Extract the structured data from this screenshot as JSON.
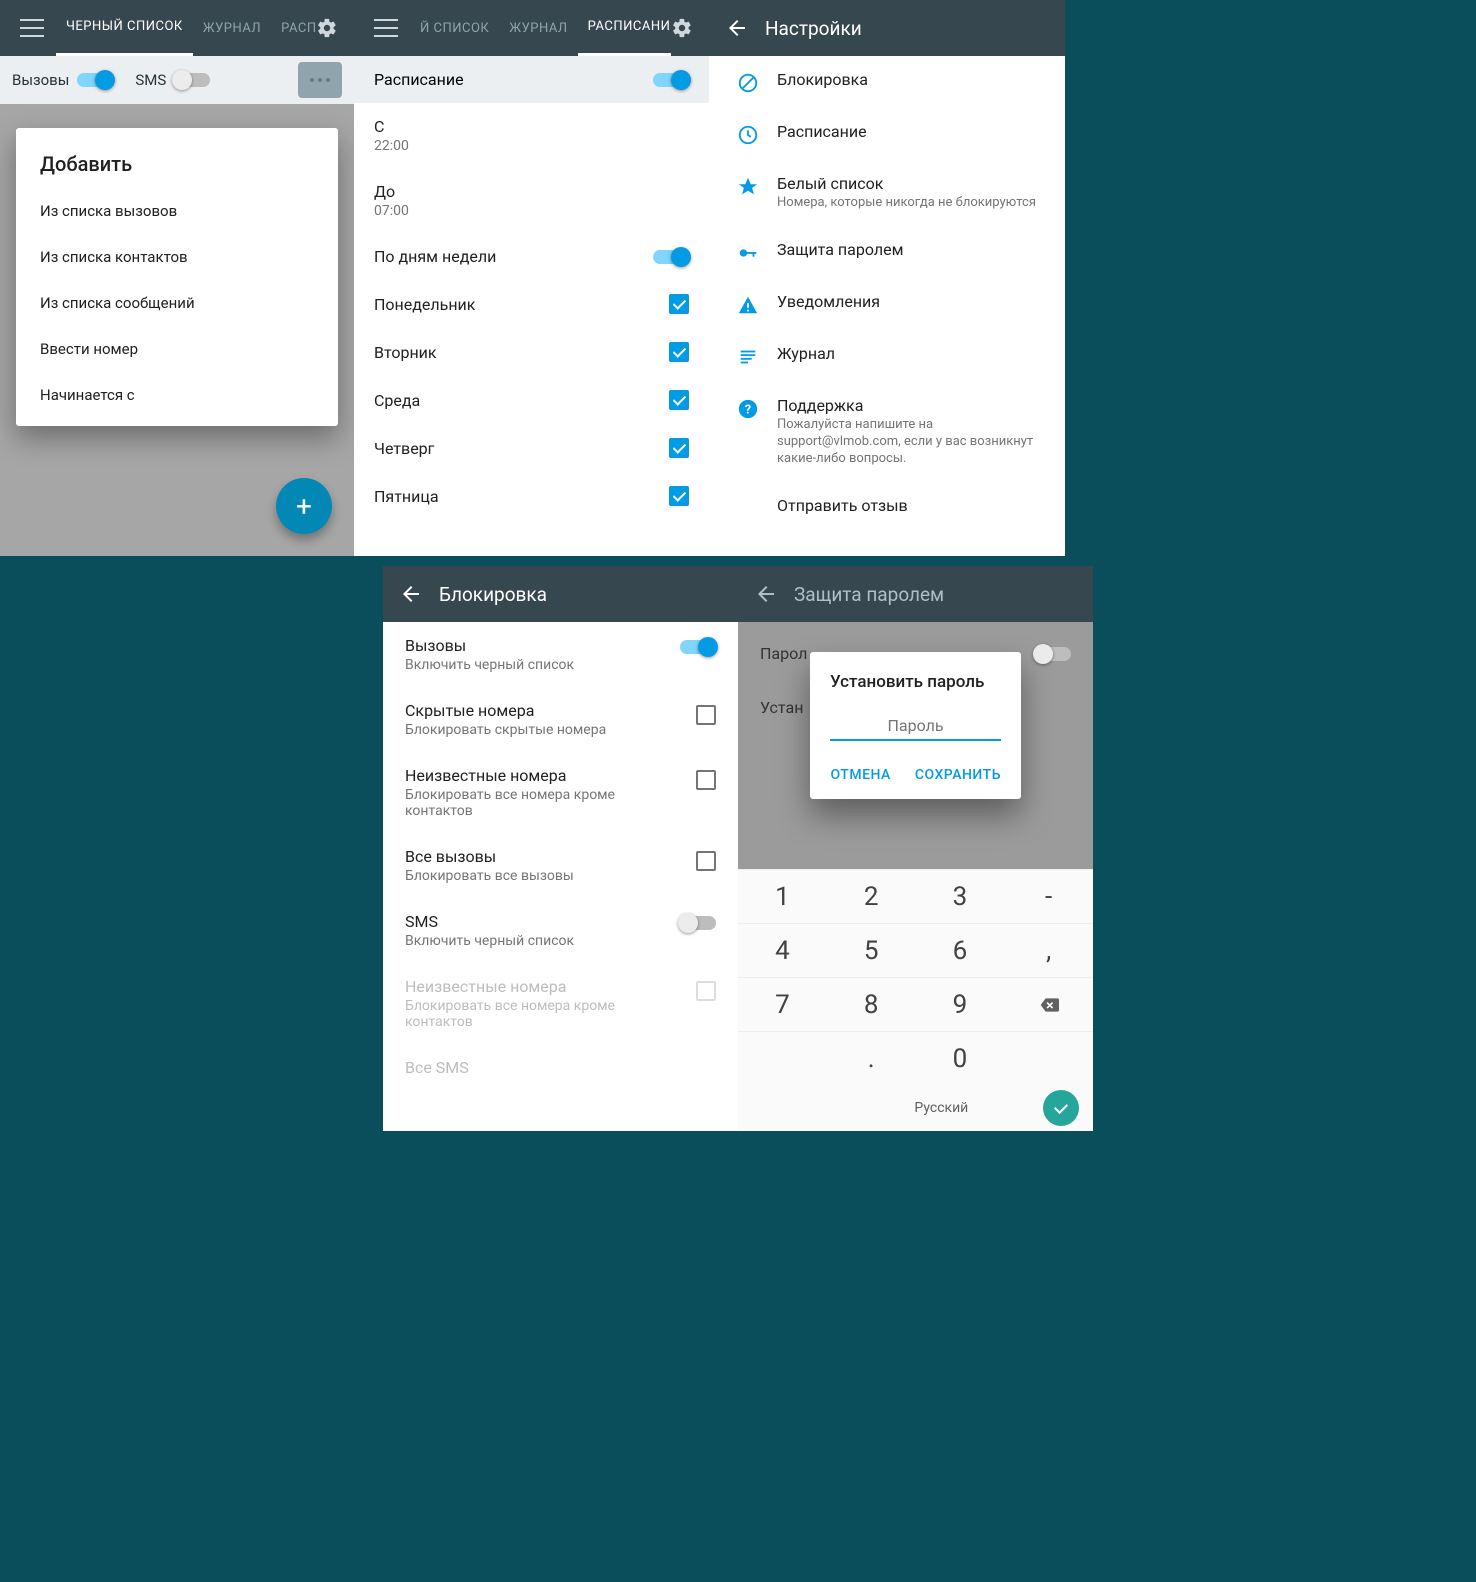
{
  "p1": {
    "tabs": [
      "ЧЕРНЫЙ СПИСОК",
      "ЖУРНАЛ",
      "РАСПИ"
    ],
    "filter": {
      "calls": "Вызовы",
      "sms": "SMS"
    },
    "dialog_title": "Добавить",
    "options": [
      "Из списка вызовов",
      "Из списка контактов",
      "Из списка сообщений",
      "Ввести номер",
      "Начинается с"
    ]
  },
  "p2": {
    "tabs": [
      "Й СПИСОК",
      "ЖУРНАЛ",
      "РАСПИСАНИЕ"
    ],
    "schedule_label": "Расписание",
    "from_label": "С",
    "from_value": "22:00",
    "to_label": "До",
    "to_value": "07:00",
    "weekday_label": "По дням недели",
    "days": [
      "Понедельник",
      "Вторник",
      "Среда",
      "Четверг",
      "Пятница"
    ]
  },
  "p3": {
    "title": "Настройки",
    "items": [
      {
        "title": "Блокировка",
        "desc": ""
      },
      {
        "title": "Расписание",
        "desc": ""
      },
      {
        "title": "Белый список",
        "desc": "Номера, которые никогда не блокируются"
      },
      {
        "title": "Защита паролем",
        "desc": ""
      },
      {
        "title": "Уведомления",
        "desc": ""
      },
      {
        "title": "Журнал",
        "desc": ""
      },
      {
        "title": "Поддержка",
        "desc": "Пожалуйста напишите на support@vlmob.com, если у вас возникнут какие-либо вопросы."
      },
      {
        "title": "Отправить отзыв",
        "desc": ""
      }
    ]
  },
  "p4": {
    "title": "Блокировка",
    "rows": [
      {
        "title": "Вызовы",
        "desc": "Включить черный список",
        "ctrl": "toggle-on"
      },
      {
        "title": "Скрытые номера",
        "desc": "Блокировать скрытые номера",
        "ctrl": "check-off"
      },
      {
        "title": "Неизвестные номера",
        "desc": "Блокировать все номера кроме контактов",
        "ctrl": "check-off"
      },
      {
        "title": "Все вызовы",
        "desc": "Блокировать все вызовы",
        "ctrl": "check-off"
      },
      {
        "title": "SMS",
        "desc": "Включить черный список",
        "ctrl": "toggle-off"
      },
      {
        "title": "Неизвестные номера",
        "desc": "Блокировать все номера кроме контактов",
        "ctrl": "check-off",
        "disabled": true
      },
      {
        "title": "Все SMS",
        "desc": "",
        "ctrl": "",
        "disabled": true
      }
    ]
  },
  "p5": {
    "title": "Защита паролем",
    "bg_rows": [
      "Парол",
      "Устан"
    ],
    "dialog_title": "Установить пароль",
    "placeholder": "Пароль",
    "cancel": "ОТМЕНА",
    "save": "СОХРАНИТЬ",
    "keys": [
      [
        "1",
        "2",
        "3",
        "-"
      ],
      [
        "4",
        "5",
        "6",
        ","
      ],
      [
        "7",
        "8",
        "9",
        "⌫"
      ],
      [
        "",
        ".",
        "0",
        ""
      ]
    ],
    "lang": "Русский"
  }
}
